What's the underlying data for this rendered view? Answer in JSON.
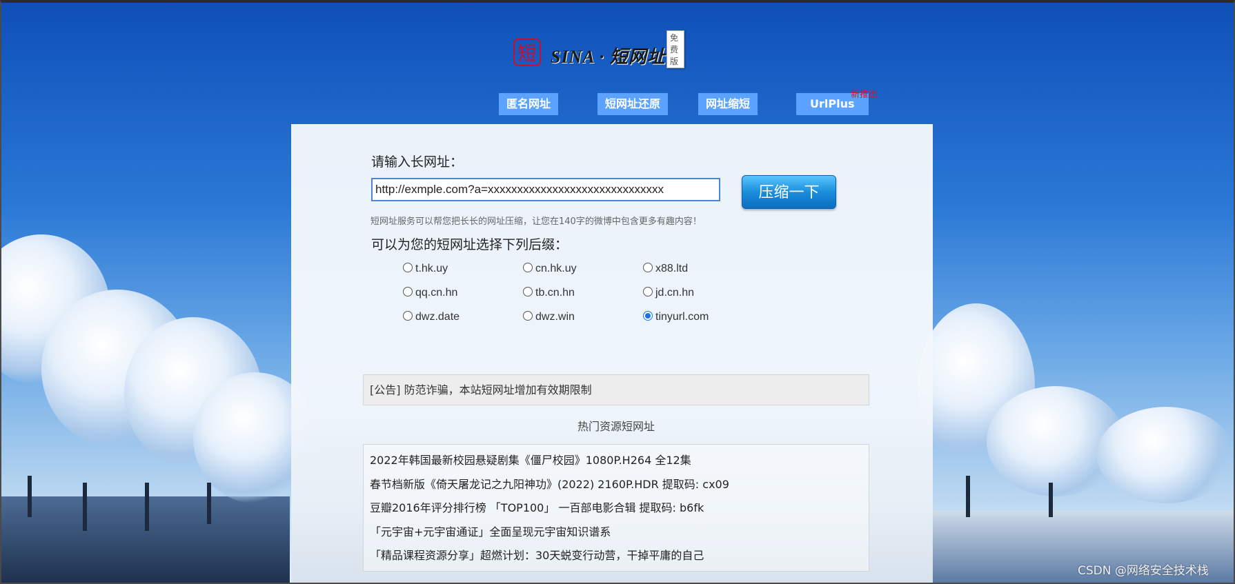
{
  "logo": {
    "seal_char": "短",
    "brand_text": "SINA · 短网址",
    "badge": "免费版"
  },
  "nav": {
    "items": [
      {
        "label": "匿名网址"
      },
      {
        "label": "短网址还原"
      },
      {
        "label": "网址缩短"
      },
      {
        "label": "UrlPlus"
      }
    ],
    "new_tag": "新推出"
  },
  "form": {
    "input_label": "请输入长网址：",
    "url_value": "http://exmple.com?a=xxxxxxxxxxxxxxxxxxxxxxxxxxxxxx",
    "submit_label": "压缩一下",
    "hint": "短网址服务可以帮您把长长的网址压缩，让您在140字的微博中包含更多有趣内容！",
    "suffix_label": "可以为您的短网址选择下列后缀：",
    "suffixes": [
      {
        "label": "t.hk.uy",
        "checked": false
      },
      {
        "label": "cn.hk.uy",
        "checked": false
      },
      {
        "label": "x88.ltd",
        "checked": false
      },
      {
        "label": "qq.cn.hn",
        "checked": false
      },
      {
        "label": "tb.cn.hn",
        "checked": false
      },
      {
        "label": "jd.cn.hn",
        "checked": false
      },
      {
        "label": "dwz.date",
        "checked": false
      },
      {
        "label": "dwz.win",
        "checked": false
      },
      {
        "label": "tinyurl.com",
        "checked": true
      }
    ]
  },
  "notice": "[公告] 防范诈骗，本站短网址增加有效期限制",
  "hot": {
    "title": "热门资源短网址",
    "items": [
      "2022年韩国最新校园悬疑剧集《僵尸校园》1080P.H264 全12集",
      "春节档新版《倚天屠龙记之九阳神功》(2022) 2160P.HDR   提取码: cx09",
      "豆瓣2016年评分排行榜 「TOP100」 一百部电影合辑   提取码: b6fk",
      "「元宇宙+元宇宙通证」全面呈现元宇宙知识谱系",
      "「精品课程资源分享」超燃计划：30天蜕变行动营，干掉平庸的自己"
    ]
  },
  "watermark": "CSDN @网络安全技术栈",
  "colors": {
    "nav_button": "#5ba3ff",
    "submit_button": "#1a8ddb",
    "new_tag": "#e0102a",
    "seal": "#c8102e"
  }
}
